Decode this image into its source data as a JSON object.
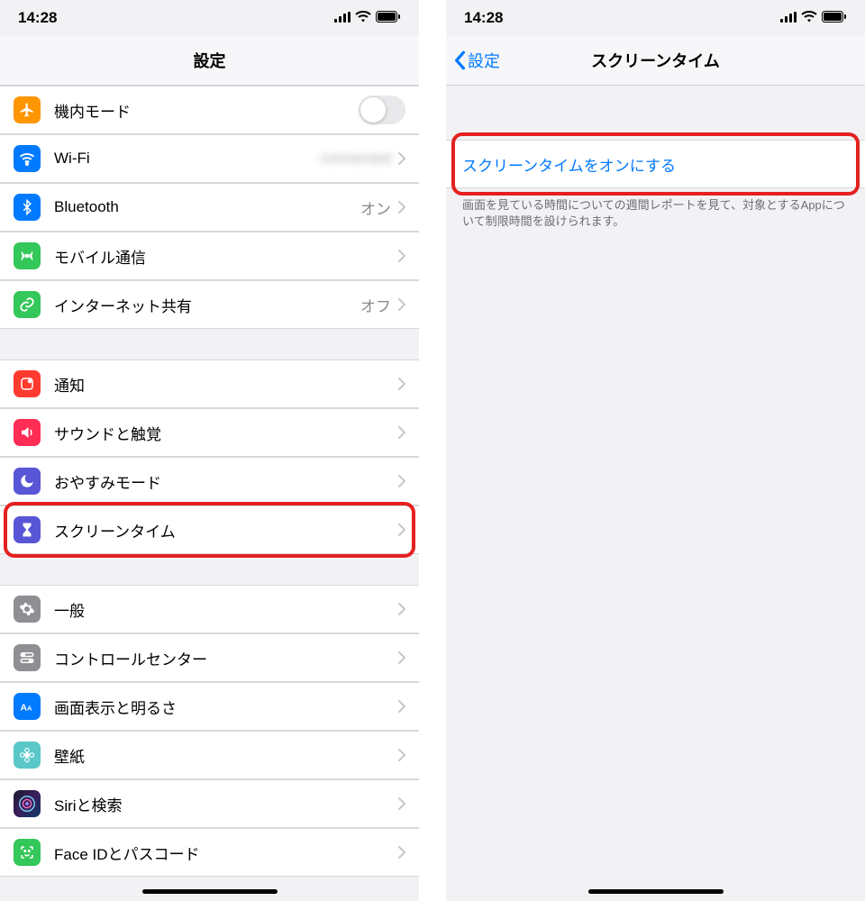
{
  "status": {
    "time": "14:28"
  },
  "left": {
    "title": "設定",
    "groups": [
      [
        {
          "key": "airplane",
          "label": "機内モード",
          "icon": "airplane-icon",
          "bg": "bg-orange",
          "toggle": true
        },
        {
          "key": "wifi",
          "label": "Wi-Fi",
          "icon": "wifi-icon",
          "bg": "bg-blue",
          "value": "",
          "blur": true,
          "chevron": true
        },
        {
          "key": "bluetooth",
          "label": "Bluetooth",
          "icon": "bluetooth-icon",
          "bg": "bg-btblue",
          "value": "オン",
          "chevron": true
        },
        {
          "key": "cellular",
          "label": "モバイル通信",
          "icon": "antenna-icon",
          "bg": "bg-green",
          "chevron": true
        },
        {
          "key": "hotspot",
          "label": "インターネット共有",
          "icon": "link-icon",
          "bg": "bg-green2",
          "value": "オフ",
          "chevron": true
        }
      ],
      [
        {
          "key": "notification",
          "label": "通知",
          "icon": "bell-icon",
          "bg": "bg-red",
          "chevron": true
        },
        {
          "key": "sounds",
          "label": "サウンドと触覚",
          "icon": "speaker-icon",
          "bg": "bg-pink",
          "chevron": true
        },
        {
          "key": "dnd",
          "label": "おやすみモード",
          "icon": "moon-icon",
          "bg": "bg-purple",
          "chevron": true
        },
        {
          "key": "screentime",
          "label": "スクリーンタイム",
          "icon": "hourglass-icon",
          "bg": "bg-purple2",
          "chevron": true,
          "highlight": true
        }
      ],
      [
        {
          "key": "general",
          "label": "一般",
          "icon": "gear-icon",
          "bg": "bg-gray",
          "chevron": true
        },
        {
          "key": "control",
          "label": "コントロールセンター",
          "icon": "switches-icon",
          "bg": "bg-gray2",
          "chevron": true
        },
        {
          "key": "display",
          "label": "画面表示と明るさ",
          "icon": "text-size-icon",
          "bg": "bg-blue2",
          "chevron": true
        },
        {
          "key": "wallpaper",
          "label": "壁紙",
          "icon": "flower-icon",
          "bg": "bg-teal",
          "chevron": true
        },
        {
          "key": "siri",
          "label": "Siriと検索",
          "icon": "siri-icon",
          "bg": "bg-siri",
          "chevron": true
        },
        {
          "key": "faceid",
          "label": "Face IDとパスコード",
          "icon": "faceid-icon",
          "bg": "bg-green3",
          "chevron": true
        }
      ]
    ]
  },
  "right": {
    "back": "設定",
    "title": "スクリーンタイム",
    "action": "スクリーンタイムをオンにする",
    "note": "画面を見ている時間についての週間レポートを見て、対象とするAppについて制限時間を設けられます。"
  }
}
